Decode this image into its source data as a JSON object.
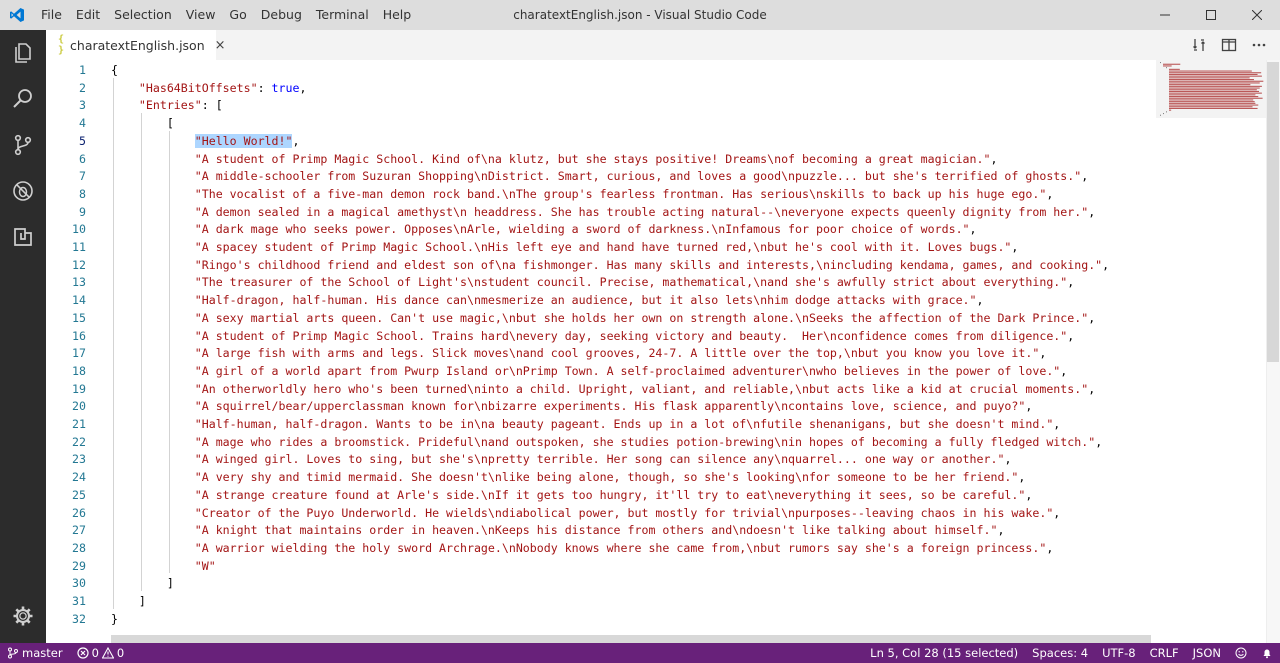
{
  "window": {
    "title": "charatextEnglish.json - Visual Studio Code"
  },
  "menu": [
    {
      "label": "File",
      "name": "menu-file"
    },
    {
      "label": "Edit",
      "name": "menu-edit"
    },
    {
      "label": "Selection",
      "name": "menu-selection"
    },
    {
      "label": "View",
      "name": "menu-view"
    },
    {
      "label": "Go",
      "name": "menu-go"
    },
    {
      "label": "Debug",
      "name": "menu-debug"
    },
    {
      "label": "Terminal",
      "name": "menu-terminal"
    },
    {
      "label": "Help",
      "name": "menu-help"
    }
  ],
  "tab": {
    "icon": "{ }",
    "label": "charatextEnglish.json",
    "close": "×"
  },
  "editor": {
    "active_line": 5,
    "lines": [
      {
        "n": 1,
        "indent": 0,
        "parts": [
          [
            "punct",
            "{"
          ]
        ]
      },
      {
        "n": 2,
        "indent": 1,
        "parts": [
          [
            "key",
            "\"Has64BitOffsets\""
          ],
          [
            "punct",
            ": "
          ],
          [
            "bool",
            "true"
          ],
          [
            "punct",
            ","
          ]
        ]
      },
      {
        "n": 3,
        "indent": 1,
        "parts": [
          [
            "key",
            "\"Entries\""
          ],
          [
            "punct",
            ": ["
          ]
        ]
      },
      {
        "n": 4,
        "indent": 2,
        "parts": [
          [
            "punct",
            "["
          ]
        ]
      },
      {
        "n": 5,
        "indent": 3,
        "parts": [
          [
            "sel",
            "\"Hello World!\""
          ],
          [
            "punct",
            ","
          ]
        ]
      },
      {
        "n": 6,
        "indent": 3,
        "parts": [
          [
            "str",
            "\"A student of Primp Magic School. Kind of\\na klutz, but she stays positive! Dreams\\nof becoming a great magician.\""
          ],
          [
            "punct",
            ","
          ]
        ]
      },
      {
        "n": 7,
        "indent": 3,
        "parts": [
          [
            "str",
            "\"A middle-schooler from Suzuran Shopping\\nDistrict. Smart, curious, and loves a good\\npuzzle... but she's terrified of ghosts.\""
          ],
          [
            "punct",
            ","
          ]
        ]
      },
      {
        "n": 8,
        "indent": 3,
        "parts": [
          [
            "str",
            "\"The vocalist of a five-man demon rock band.\\nThe group's fearless frontman. Has serious\\nskills to back up his huge ego.\""
          ],
          [
            "punct",
            ","
          ]
        ]
      },
      {
        "n": 9,
        "indent": 3,
        "parts": [
          [
            "str",
            "\"A demon sealed in a magical amethyst\\n headdress. She has trouble acting natural--\\neveryone expects queenly dignity from her.\""
          ],
          [
            "punct",
            ","
          ]
        ]
      },
      {
        "n": 10,
        "indent": 3,
        "parts": [
          [
            "str",
            "\"A dark mage who seeks power. Opposes\\nArle, wielding a sword of darkness.\\nInfamous for poor choice of words.\""
          ],
          [
            "punct",
            ","
          ]
        ]
      },
      {
        "n": 11,
        "indent": 3,
        "parts": [
          [
            "str",
            "\"A spacey student of Primp Magic School.\\nHis left eye and hand have turned red,\\nbut he's cool with it. Loves bugs.\""
          ],
          [
            "punct",
            ","
          ]
        ]
      },
      {
        "n": 12,
        "indent": 3,
        "parts": [
          [
            "str",
            "\"Ringo's childhood friend and eldest son of\\na fishmonger. Has many skills and interests,\\nincluding kendama, games, and cooking.\""
          ],
          [
            "punct",
            ","
          ]
        ]
      },
      {
        "n": 13,
        "indent": 3,
        "parts": [
          [
            "str",
            "\"The treasurer of the School of Light's\\nstudent council. Precise, mathematical,\\nand she's awfully strict about everything.\""
          ],
          [
            "punct",
            ","
          ]
        ]
      },
      {
        "n": 14,
        "indent": 3,
        "parts": [
          [
            "str",
            "\"Half-dragon, half-human. His dance can\\nmesmerize an audience, but it also lets\\nhim dodge attacks with grace.\""
          ],
          [
            "punct",
            ","
          ]
        ]
      },
      {
        "n": 15,
        "indent": 3,
        "parts": [
          [
            "str",
            "\"A sexy martial arts queen. Can't use magic,\\nbut she holds her own on strength alone.\\nSeeks the affection of the Dark Prince.\""
          ],
          [
            "punct",
            ","
          ]
        ]
      },
      {
        "n": 16,
        "indent": 3,
        "parts": [
          [
            "str",
            "\"A student of Primp Magic School. Trains hard\\nevery day, seeking victory and beauty.  Her\\nconfidence comes from diligence.\""
          ],
          [
            "punct",
            ","
          ]
        ]
      },
      {
        "n": 17,
        "indent": 3,
        "parts": [
          [
            "str",
            "\"A large fish with arms and legs. Slick moves\\nand cool grooves, 24-7. A little over the top,\\nbut you know you love it.\""
          ],
          [
            "punct",
            ","
          ]
        ]
      },
      {
        "n": 18,
        "indent": 3,
        "parts": [
          [
            "str",
            "\"A girl of a world apart from Pwurp Island or\\nPrimp Town. A self-proclaimed adventurer\\nwho believes in the power of love.\""
          ],
          [
            "punct",
            ","
          ]
        ]
      },
      {
        "n": 19,
        "indent": 3,
        "parts": [
          [
            "str",
            "\"An otherworldly hero who's been turned\\ninto a child. Upright, valiant, and reliable,\\nbut acts like a kid at crucial moments.\""
          ],
          [
            "punct",
            ","
          ]
        ]
      },
      {
        "n": 20,
        "indent": 3,
        "parts": [
          [
            "str",
            "\"A squirrel/bear/upperclassman known for\\nbizarre experiments. His flask apparently\\ncontains love, science, and puyo?\""
          ],
          [
            "punct",
            ","
          ]
        ]
      },
      {
        "n": 21,
        "indent": 3,
        "parts": [
          [
            "str",
            "\"Half-human, half-dragon. Wants to be in\\na beauty pageant. Ends up in a lot of\\nfutile shenanigans, but she doesn't mind.\""
          ],
          [
            "punct",
            ","
          ]
        ]
      },
      {
        "n": 22,
        "indent": 3,
        "parts": [
          [
            "str",
            "\"A mage who rides a broomstick. Prideful\\nand outspoken, she studies potion-brewing\\nin hopes of becoming a fully fledged witch.\""
          ],
          [
            "punct",
            ","
          ]
        ]
      },
      {
        "n": 23,
        "indent": 3,
        "parts": [
          [
            "str",
            "\"A winged girl. Loves to sing, but she's\\npretty terrible. Her song can silence any\\nquarrel... one way or another.\""
          ],
          [
            "punct",
            ","
          ]
        ]
      },
      {
        "n": 24,
        "indent": 3,
        "parts": [
          [
            "str",
            "\"A very shy and timid mermaid. She doesn't\\nlike being alone, though, so she's looking\\nfor someone to be her friend.\""
          ],
          [
            "punct",
            ","
          ]
        ]
      },
      {
        "n": 25,
        "indent": 3,
        "parts": [
          [
            "str",
            "\"A strange creature found at Arle's side.\\nIf it gets too hungry, it'll try to eat\\neverything it sees, so be careful.\""
          ],
          [
            "punct",
            ","
          ]
        ]
      },
      {
        "n": 26,
        "indent": 3,
        "parts": [
          [
            "str",
            "\"Creator of the Puyo Underworld. He wields\\ndiabolical power, but mostly for trivial\\npurposes--leaving chaos in his wake.\""
          ],
          [
            "punct",
            ","
          ]
        ]
      },
      {
        "n": 27,
        "indent": 3,
        "parts": [
          [
            "str",
            "\"A knight that maintains order in heaven.\\nKeeps his distance from others and\\ndoesn't like talking about himself.\""
          ],
          [
            "punct",
            ","
          ]
        ]
      },
      {
        "n": 28,
        "indent": 3,
        "parts": [
          [
            "str",
            "\"A warrior wielding the holy sword Archrage.\\nNobody knows where she came from,\\nbut rumors say she's a foreign princess.\""
          ],
          [
            "punct",
            ","
          ]
        ]
      },
      {
        "n": 29,
        "indent": 3,
        "parts": [
          [
            "str",
            "\"W\""
          ]
        ]
      },
      {
        "n": 30,
        "indent": 2,
        "parts": [
          [
            "punct",
            "]"
          ]
        ]
      },
      {
        "n": 31,
        "indent": 1,
        "parts": [
          [
            "punct",
            "]"
          ]
        ]
      },
      {
        "n": 32,
        "indent": 0,
        "parts": [
          [
            "punct",
            "}"
          ]
        ]
      }
    ]
  },
  "status": {
    "branch": "master",
    "errors": "0",
    "warnings": "0",
    "position": "Ln 5, Col 28 (15 selected)",
    "spaces": "Spaces: 4",
    "encoding": "UTF-8",
    "eol": "CRLF",
    "language": "JSON"
  },
  "colors": {
    "activitybar": "#2c2c2c",
    "statusbar": "#68217a",
    "string": "#a31515",
    "keyword": "#0000ff",
    "selection": "#add6ff",
    "line_number": "#237893"
  }
}
